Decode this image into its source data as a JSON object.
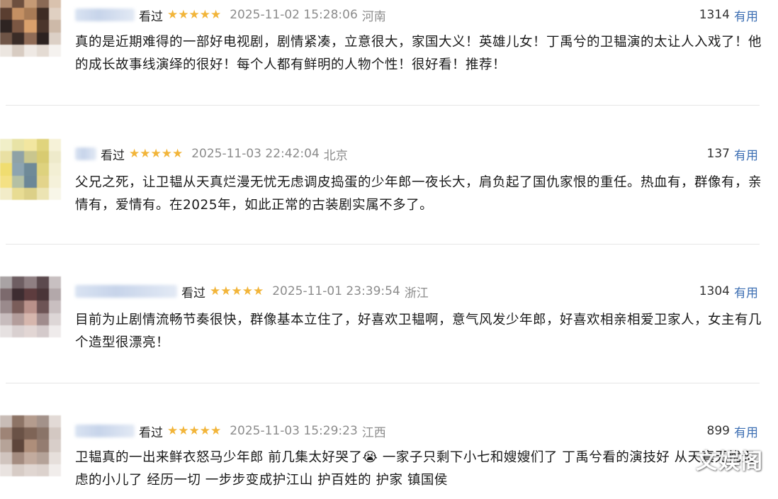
{
  "reviews": [
    {
      "status": "看过",
      "stars": "★★★★★",
      "time": "2025-11-02 15:28:06",
      "region": "河南",
      "useful_count": "1314",
      "useful_label": "有用",
      "text": "真的是近期难得的一部好电视剧，剧情紧凑，立意很大，家国大义！英雄儿女！丁禹兮的卫韫演的太让人入戏了！他的成长故事线演绎的很好！每个人都有鲜明的人物个性！很好看！推荐！"
    },
    {
      "status": "看过",
      "stars": "★★★★★",
      "time": "2025-11-03 22:42:04",
      "region": "北京",
      "useful_count": "137",
      "useful_label": "有用",
      "text": "父兄之死，让卫韫从天真烂漫无忧无虑调皮捣蛋的少年郎一夜长大，肩负起了国仇家恨的重任。热血有，群像有，亲情有，爱情有。在2025年，如此正常的古装剧实属不多了。"
    },
    {
      "status": "看过",
      "stars": "★★★★★",
      "time": "2025-11-01 23:39:54",
      "region": "浙江",
      "useful_count": "1304",
      "useful_label": "有用",
      "text": "目前为止剧情流畅节奏很快，群像基本立住了，好喜欢卫韫啊，意气风发少年郎，好喜欢相亲相爱卫家人，女主有几个造型很漂亮！"
    },
    {
      "status": "看过",
      "stars": "★★★★★",
      "time": "2025-11-03 15:29:23",
      "region": "江西",
      "useful_count": "899",
      "useful_label": "有用",
      "text": "卫韫真的一出来鲜衣怒马少年郎 前几集太好哭了😭 一家子只剩下小七和嫂嫂们了 丁禹兮看的演技好 从天真无忧无虑的小儿了 经历一切 一步步变成护江山 护百姓的 护家 镇国侯"
    }
  ],
  "watermark": "文娱阁",
  "colors": {
    "stars": "#f2b53a",
    "useful_label": "#3d6fb3",
    "time": "#8c8c8c"
  }
}
